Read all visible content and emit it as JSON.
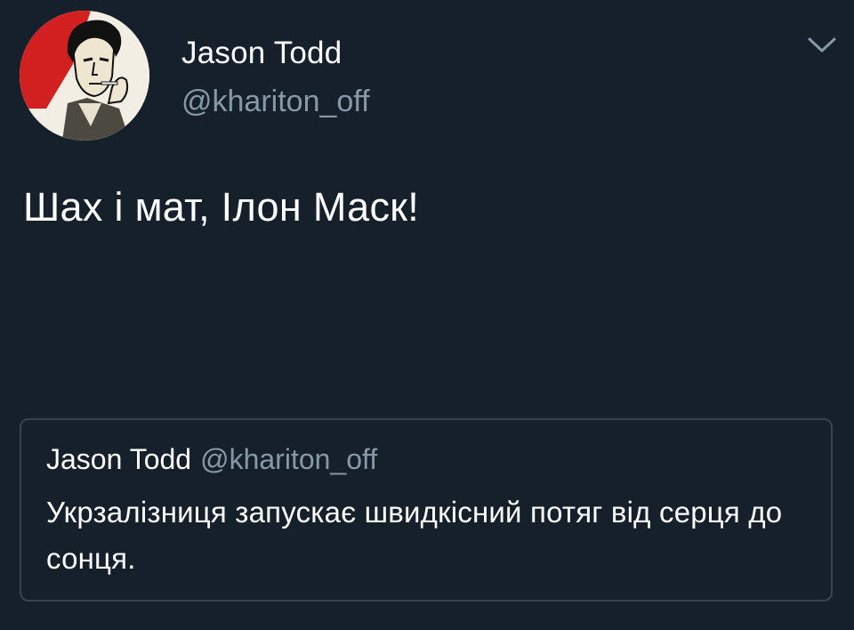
{
  "tweet": {
    "author": {
      "display_name": "Jason Todd",
      "handle": "@khariton_off",
      "avatar_icon": "avatar-illustration"
    },
    "menu_icon": "chevron-down-icon",
    "text": "Шах і мат, Ілон Маск!",
    "quoted_tweet": {
      "display_name": "Jason Todd",
      "handle": "@khariton_off",
      "text": "Укрзалізниця запускає швидкісний потяг від серця до сонця."
    }
  },
  "colors": {
    "background": "#15202b",
    "secondary_text": "#8899a6",
    "border": "#38444d",
    "avatar_red": "#d21f1f"
  }
}
